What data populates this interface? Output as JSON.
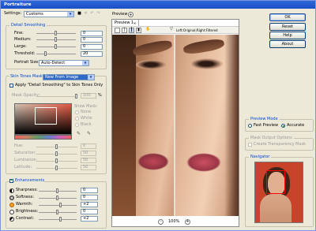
{
  "window": {
    "title": "Portraiture"
  },
  "settings": {
    "label": "Settings:",
    "value": "Customs"
  },
  "header_icons": [
    "save-icon",
    "delete-icon",
    "undo-icon",
    "redo-icon"
  ],
  "detail_smoothing": {
    "title": "Detail Smoothing",
    "rows": [
      {
        "label": "Fine:",
        "value": "0"
      },
      {
        "label": "Medium:",
        "value": "0"
      },
      {
        "label": "Large:",
        "value": "0"
      },
      {
        "label": "Threshold:",
        "value": "20"
      }
    ],
    "portrait_size_label": "Portrait Size:",
    "portrait_size_value": "Auto-Detect"
  },
  "skin_tones_mask": {
    "title": "Skin Tones Mask:",
    "mode_value": "New From Image",
    "apply_label": "Apply \"Detail Smoothing\" to Skin Tones Only",
    "mask_opacity_label": "Mask Opacity:",
    "mask_opacity_value": "100",
    "mask_opacity_unit": "%",
    "show_mask_label": "Show Mask:",
    "show_mask_options": [
      "None",
      "White",
      "Black"
    ],
    "rows": [
      {
        "label": "Hue:",
        "value": "0"
      },
      {
        "label": "Saturation:",
        "value": "50"
      },
      {
        "label": "Luminance:",
        "value": "50"
      },
      {
        "label": "Latitude:",
        "value": "50"
      }
    ]
  },
  "enhancements": {
    "title": "Enhancements",
    "rows": [
      {
        "label": "Sharpness:",
        "value": "0"
      },
      {
        "label": "Softness:",
        "value": "0"
      },
      {
        "label": "Warmth:",
        "value": "+2"
      },
      {
        "label": "Brightness:",
        "value": "0"
      },
      {
        "label": "Contrast:",
        "value": "+2"
      }
    ]
  },
  "preview": {
    "title": "Preview",
    "tab_label": "Preview 1",
    "view_label": "Left:Original;Right:Filtered",
    "zoom": "100%",
    "zoom_minus": "-",
    "zoom_plus": "+"
  },
  "buttons": {
    "ok": "OK",
    "reset": "Reset",
    "help": "Help",
    "about": "About"
  },
  "preview_mode": {
    "title": "Preview Mode",
    "options": [
      "Fast Preview",
      "Accurate"
    ]
  },
  "mask_output": {
    "title": "Mask Output Options",
    "create_label": "Create Transparency Mask"
  },
  "navigator": {
    "title": "Navigator"
  },
  "colors": {
    "title_bar": "#1a4fc5",
    "group_title": "#0046d5",
    "face_bg": "#8b5a3c",
    "navigator_bg": "#c9432b"
  }
}
